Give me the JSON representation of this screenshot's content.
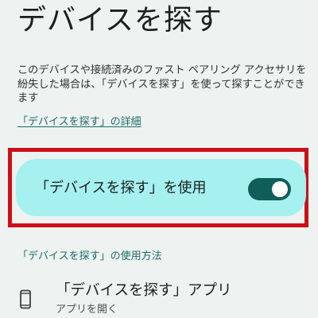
{
  "header": {
    "title": "デバイスを探す"
  },
  "intro": {
    "description": "このデバイスや接続済みのファスト ペアリング アクセサリを紛失した場合は、「デバイスを探す」を使って探すことができます",
    "details_link": "「デバイスを探す」の詳細"
  },
  "use_toggle": {
    "label": "「デバイスを探す」を使用",
    "enabled": true
  },
  "howto": {
    "label": "「デバイスを探す」の使用方法"
  },
  "app": {
    "title": "「デバイスを探す」アプリ",
    "subtitle": "アプリを開く",
    "icon": "phone-icon"
  },
  "colors": {
    "background": "#eef2f1",
    "card": "#a6f0f0",
    "toggle_on": "#0f5e5a",
    "link": "#1d6b66",
    "highlight": "#cc1018"
  }
}
